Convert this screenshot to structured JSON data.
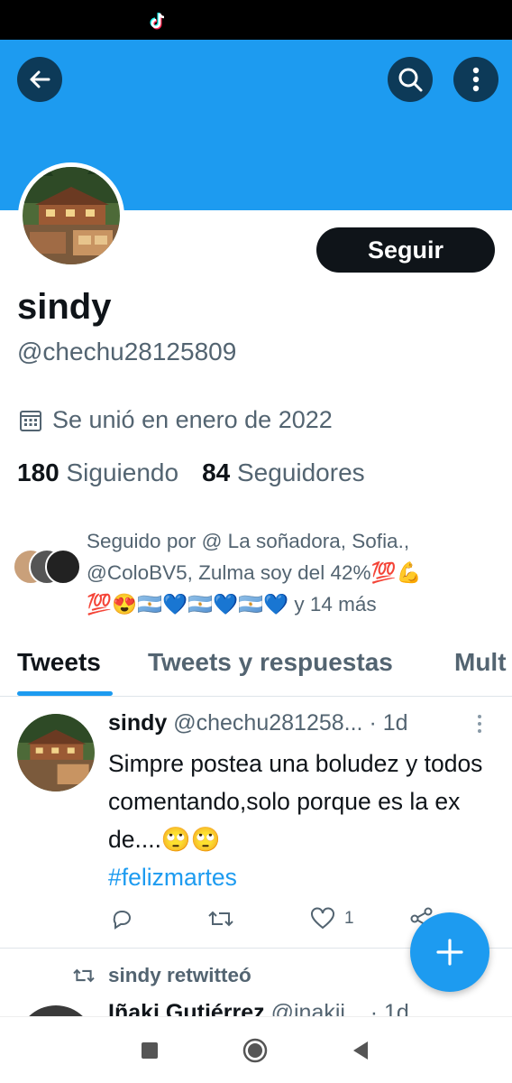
{
  "profile": {
    "name": "sindy",
    "handle": "@chechu28125809",
    "joined": "Se unió en enero de 2022",
    "following_count": "180",
    "following_label": "Siguiendo",
    "followers_count": "84",
    "followers_label": "Seguidores",
    "follow_button": "Seguir"
  },
  "followed_by": {
    "line1": "Seguido por @ La soñadora, Sofia.,",
    "line2": "@ColoBV5, Zulma soy del 42%💯💪",
    "line3_emojis": "💯😍🇦🇷💙🇦🇷💙🇦🇷💙",
    "line3_more": " y 14 más"
  },
  "tabs": [
    "Tweets",
    "Tweets y respuestas",
    "Mult"
  ],
  "tweet": {
    "name": "sindy",
    "handle_time": " @chechu281258... · 1d",
    "text": "Simpre postea una boludez y todos comentando,solo porque es la ex de....🙄🙄",
    "hashtag": "#felizmartes",
    "like_count": "1"
  },
  "retweet": {
    "label": "sindy retwitteó",
    "name": "Iñaki Gutiérrez",
    "handle_time": " @inakii... · 1d"
  },
  "colors": {
    "accent": "#1d9bf0",
    "banner": "#1d9bf0",
    "text_primary": "#0f1419",
    "text_secondary": "#536471"
  },
  "icons": [
    "tiktok-icon",
    "back-arrow-icon",
    "search-icon",
    "more-vertical-icon",
    "calendar-icon",
    "reply-icon",
    "retweet-icon",
    "like-icon",
    "share-icon",
    "plus-icon",
    "nav-square-icon",
    "nav-circle-icon",
    "nav-triangle-icon"
  ]
}
